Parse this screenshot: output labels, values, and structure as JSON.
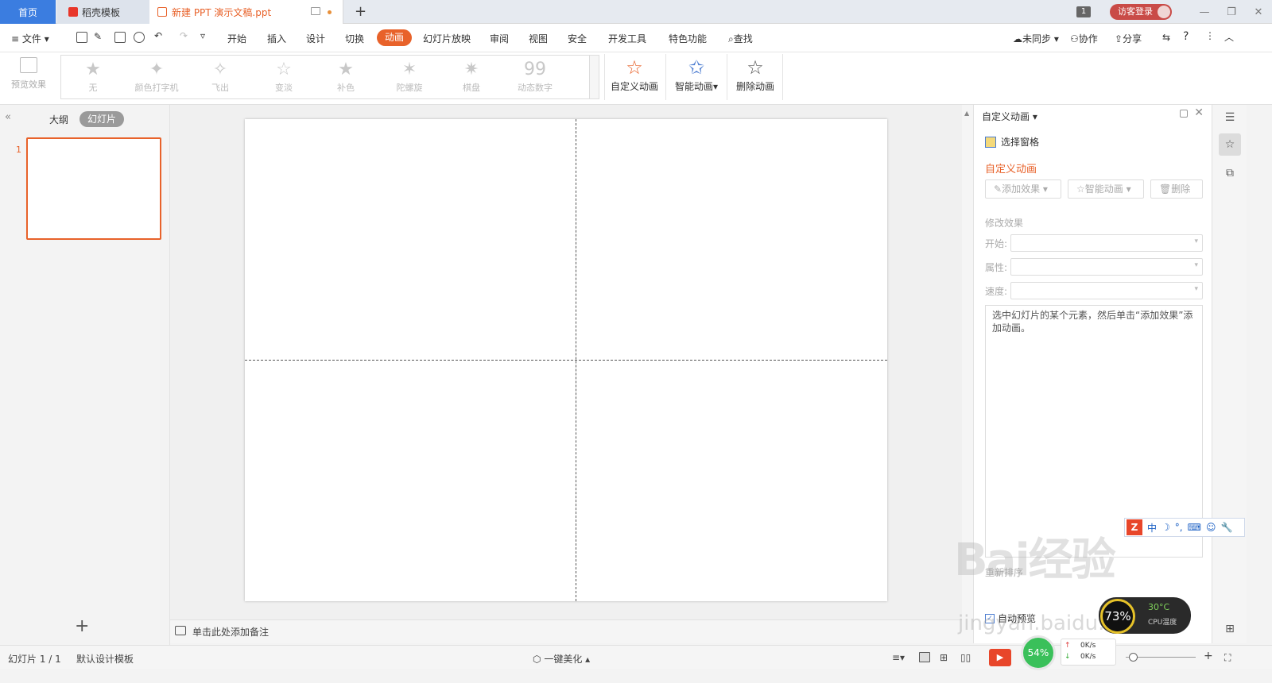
{
  "tabs": {
    "home": "首页",
    "template": "稻壳模板",
    "document": "新建 PPT 演示文稿.ppt"
  },
  "window": {
    "badge": "1",
    "login": "访客登录"
  },
  "menu": {
    "file": "文件",
    "items": [
      "开始",
      "插入",
      "设计",
      "切换",
      "动画",
      "幻灯片放映",
      "审阅",
      "视图",
      "安全",
      "开发工具",
      "特色功能"
    ],
    "active": "动画",
    "search": "查找",
    "sync": "未同步",
    "collab": "协作",
    "share": "分享"
  },
  "ribbon": {
    "preview": "预览效果",
    "effects": [
      "无",
      "颜色打字机",
      "飞出",
      "变淡",
      "补色",
      "陀螺旋",
      "棋盘",
      "动态数字"
    ],
    "custom": "自定义动画",
    "smart": "智能动画",
    "delete": "删除动画"
  },
  "left_panel": {
    "outline": "大纲",
    "slides": "幻灯片",
    "thumb_number": "1"
  },
  "notes": {
    "placeholder": "单击此处添加备注"
  },
  "right_panel": {
    "title": "自定义动画",
    "select_pane": "选择窗格",
    "section": "自定义动画",
    "add_effect": "添加效果",
    "smart_anim": "智能动画",
    "delete": "删除",
    "modify": "修改效果",
    "start": "开始:",
    "property": "属性:",
    "speed": "速度:",
    "hint": "选中幻灯片的某个元素，然后单击“添加效果”添加动画。",
    "reorder": "重新排序",
    "auto_preview": "自动预览"
  },
  "ime": {
    "items": [
      "中",
      "☽",
      "°,",
      "⌨",
      "☺",
      "🔧"
    ]
  },
  "statusbar": {
    "slide_info": "幻灯片 1 / 1",
    "template": "默认设计模板",
    "beautify": "一键美化"
  },
  "overlays": {
    "cpu_pct": "73%",
    "cpu_temp": "30°C",
    "cpu_label": "CPU温度",
    "net_pct": "54%",
    "net_up": "0K/s",
    "net_down": "0K/s",
    "watermark": "Bai经验",
    "watermark_url": "jingyan.baidu.com"
  },
  "colors": {
    "accent": "#e8622a",
    "home_tab": "#3b7de0",
    "login": "#c94b47"
  }
}
